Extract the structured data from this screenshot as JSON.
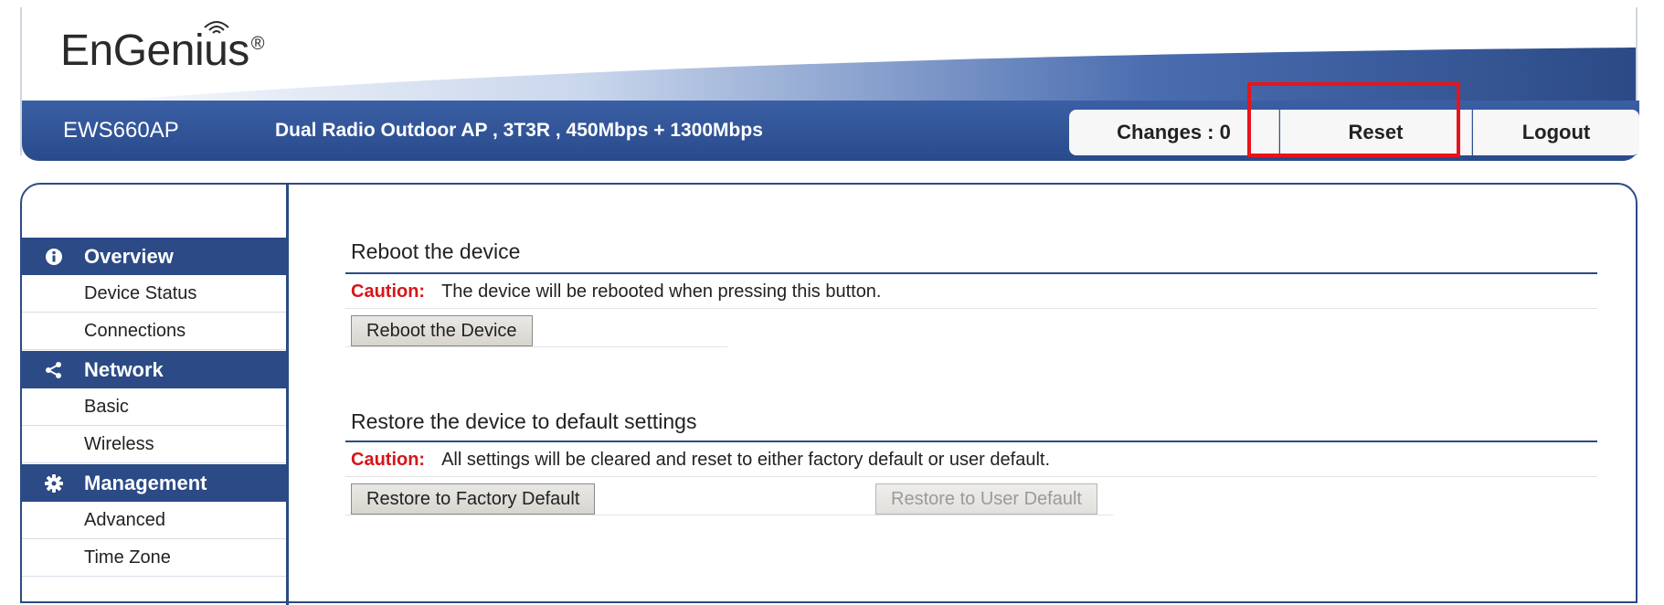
{
  "header": {
    "logo_text": "EnGenius",
    "logo_mark": "®",
    "model": "EWS660AP",
    "description": "Dual Radio Outdoor AP , 3T3R , 450Mbps + 1300Mbps",
    "changes_label": "Changes : 0",
    "reset_label": "Reset",
    "logout_label": "Logout",
    "accent_color": "#2b4a86",
    "highlight_color": "#e8141b"
  },
  "sidebar": {
    "groups": [
      {
        "label": "Overview",
        "icon": "info-icon",
        "items": [
          "Device Status",
          "Connections"
        ]
      },
      {
        "label": "Network",
        "icon": "share-icon",
        "items": [
          "Basic",
          "Wireless"
        ]
      },
      {
        "label": "Management",
        "icon": "gear-icon",
        "items": [
          "Advanced",
          "Time Zone"
        ]
      }
    ]
  },
  "reboot": {
    "title": "Reboot the device",
    "caution_label": "Caution:",
    "caution_text": "The device will be rebooted when pressing this button.",
    "button_label": "Reboot the Device"
  },
  "restore": {
    "title": "Restore the device to default settings",
    "caution_label": "Caution:",
    "caution_text": "All settings will be cleared and reset to either factory default or user default.",
    "factory_button_label": "Restore to Factory Default",
    "user_button_label": "Restore to User Default"
  }
}
